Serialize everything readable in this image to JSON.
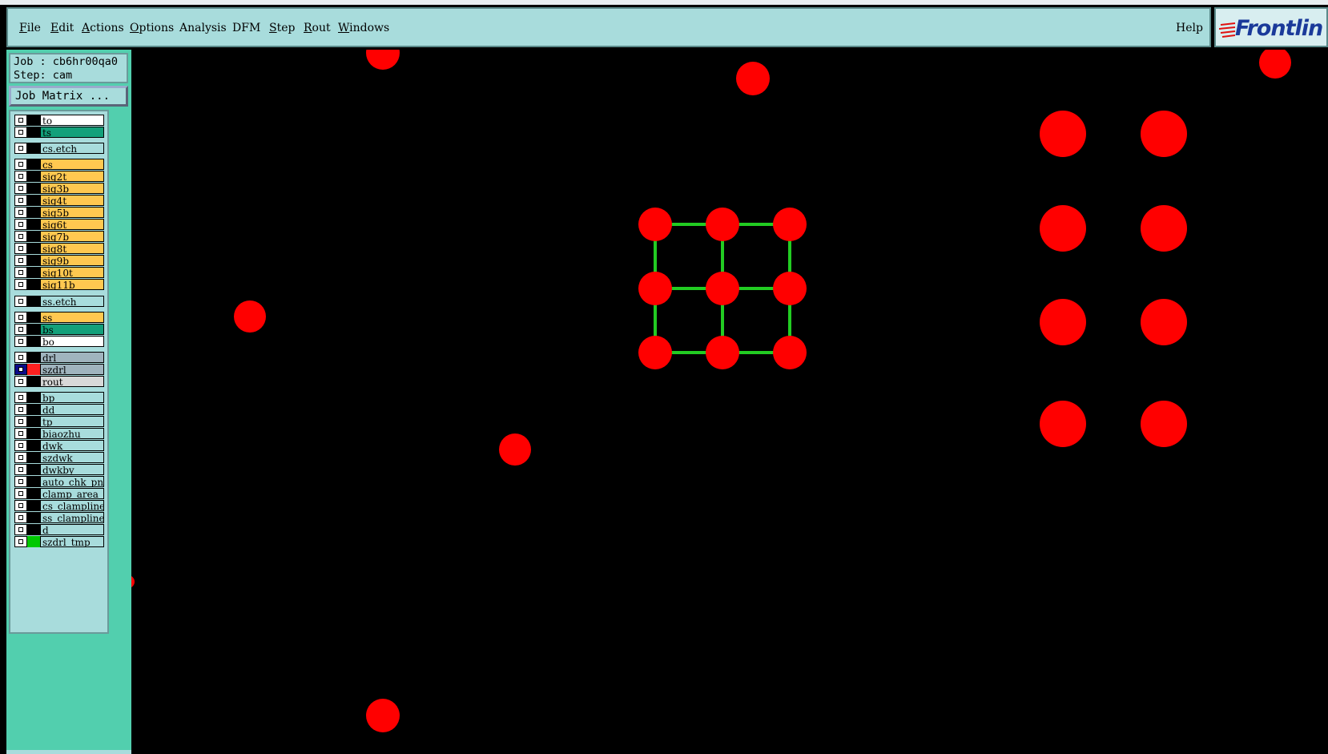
{
  "menubar": {
    "items": [
      {
        "label": "File"
      },
      {
        "label": "Edit"
      },
      {
        "label": "Actions"
      },
      {
        "label": "Options"
      },
      {
        "label": "Analysis"
      },
      {
        "label": "DFM"
      },
      {
        "label": "Step"
      },
      {
        "label": "Rout"
      },
      {
        "label": "Windows"
      }
    ],
    "help_label": "Help",
    "logo_text": "Frontlin"
  },
  "job": {
    "job_line": "Job : cb6hr00qa0",
    "step_line": "Step: cam",
    "matrix_button": "Job Matrix ..."
  },
  "layers": [
    {
      "name": "to",
      "color": "#ffffff"
    },
    {
      "name": "ts",
      "color": "#13a07a"
    },
    {
      "name": "cs.etch",
      "color": "#a8dcdc"
    },
    {
      "name": "cs",
      "color": "#ffc850"
    },
    {
      "name": "sig2t",
      "color": "#ffc850"
    },
    {
      "name": "sig3b",
      "color": "#ffc850"
    },
    {
      "name": "sig4t",
      "color": "#ffc850"
    },
    {
      "name": "sig5b",
      "color": "#ffc850"
    },
    {
      "name": "sig6t",
      "color": "#ffc850"
    },
    {
      "name": "sig7b",
      "color": "#ffc850"
    },
    {
      "name": "sig8t",
      "color": "#ffc850"
    },
    {
      "name": "sig9b",
      "color": "#ffc850"
    },
    {
      "name": "sig10t",
      "color": "#ffc850"
    },
    {
      "name": "sig11b",
      "color": "#ffc850"
    },
    {
      "name": "ss.etch",
      "color": "#a8dcdc"
    },
    {
      "name": "ss",
      "color": "#ffc850"
    },
    {
      "name": "bs",
      "color": "#13a07a"
    },
    {
      "name": "bo",
      "color": "#ffffff"
    },
    {
      "name": "drl",
      "color": "#a0b4be"
    },
    {
      "name": "szdrl",
      "color": "#a0b4be",
      "checked": true,
      "swatch": "#ff2020"
    },
    {
      "name": "rout",
      "color": "#d8d8d8"
    },
    {
      "name": "bp",
      "color": "#a8dcdc"
    },
    {
      "name": "dd",
      "color": "#a8dcdc"
    },
    {
      "name": "tp",
      "color": "#a8dcdc"
    },
    {
      "name": "biaozhu",
      "color": "#a8dcdc"
    },
    {
      "name": "dwk",
      "color": "#a8dcdc"
    },
    {
      "name": "szdwk",
      "color": "#a8dcdc"
    },
    {
      "name": "dwkby",
      "color": "#a8dcdc"
    },
    {
      "name": "auto_chk_pnl",
      "color": "#a8dcdc"
    },
    {
      "name": "clamp_area",
      "color": "#a8dcdc"
    },
    {
      "name": "cs_clampline",
      "color": "#a8dcdc"
    },
    {
      "name": "ss_clampline",
      "color": "#a8dcdc"
    },
    {
      "name": "d",
      "color": "#a8dcdc"
    },
    {
      "name": "szdrl_tmp",
      "color": "#a8dcdc",
      "swatch": "#00c800"
    }
  ],
  "canvas": {
    "background": "#000000",
    "pad_color": "#ff0000",
    "trace_color": "#22cc22"
  }
}
